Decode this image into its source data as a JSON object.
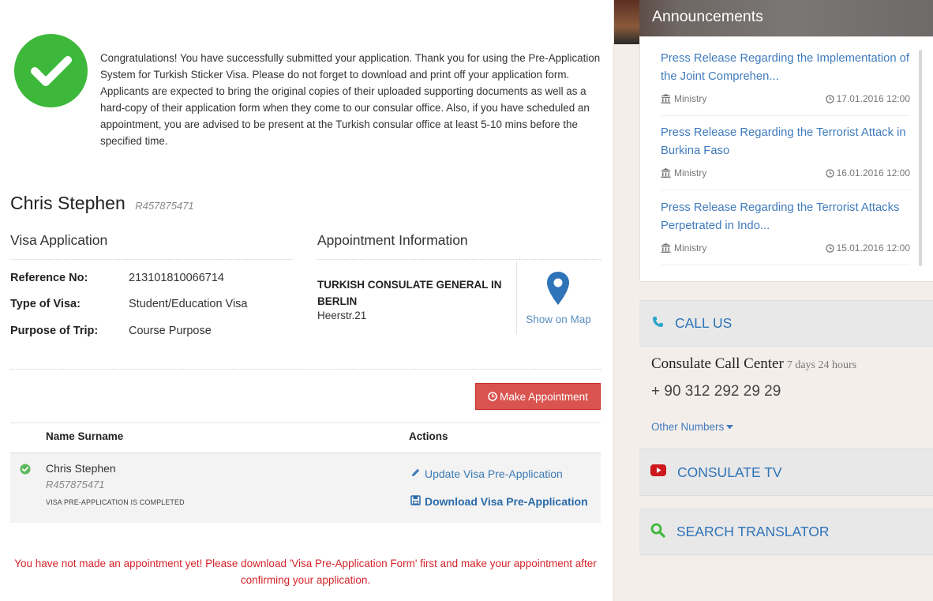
{
  "success": {
    "icon": "check-circle-icon",
    "message": "Congratulations! You have successfully submitted your application. Thank you for using the Pre-Application System for Turkish Sticker Visa. Please do not forget to download and print off your application form. Applicants are expected to bring the original copies of their uploaded supporting documents as well as a hard-copy of their application form when they come to our consular office. Also, if you have scheduled an appointment, you are advised to be present at the Turkish consular office at least 5-10 mins before the specified time."
  },
  "applicant": {
    "name": "Chris Stephen",
    "reference": "R457875471"
  },
  "visa_application": {
    "title": "Visa Application",
    "fields": [
      {
        "label": "Reference No:",
        "value": "213101810066714"
      },
      {
        "label": "Type of Visa:",
        "value": "Student/Education Visa"
      },
      {
        "label": "Purpose of Trip:",
        "value": "Course Purpose"
      }
    ]
  },
  "appointment_info": {
    "title": "Appointment Information",
    "consulate": "TURKISH CONSULATE GENERAL IN BERLIN",
    "address": "Heerstr.21",
    "map_link": "Show on Map",
    "pin_color": "#2f74b8"
  },
  "make_appointment": {
    "label": "Make Appointment",
    "icon": "clock-icon",
    "color": "#d9534f"
  },
  "table": {
    "headers": [
      "Name Surname",
      "Actions"
    ],
    "rows": [
      {
        "name": "Chris Stephen",
        "reference": "R457875471",
        "status": "VISA PRE-APPLICATION IS COMPLETED",
        "update_label": "Update Visa Pre-Application",
        "download_label": "Download Visa Pre-Application"
      }
    ]
  },
  "warning": "You have not made an appointment yet! Please download 'Visa Pre-Application Form' first and make your appointment after confirming your application.",
  "sidebar": {
    "announcements_title": "Announcements",
    "announcements": [
      {
        "title": "Press Release Regarding the Implementation of the Joint Comprehen...",
        "source": "Ministry",
        "date": "17.01.2016 12:00"
      },
      {
        "title": "Press Release Regarding the Terrorist Attack in Burkina Faso",
        "source": "Ministry",
        "date": "16.01.2016 12:00"
      },
      {
        "title": "Press Release Regarding the Terrorist Attacks Perpetrated in Indo...",
        "source": "Ministry",
        "date": "15.01.2016 12:00"
      }
    ],
    "call_us": "CALL US",
    "call_center_title": "Consulate Call Center",
    "call_center_hours": "7 days 24 hours",
    "call_center_number": "+ 90 312 292 29 29",
    "other_numbers": "Other Numbers",
    "consulate_tv": "CONSULATE TV",
    "search_translator": "SEARCH TRANSLATOR",
    "colors": {
      "link": "#3f7bbd",
      "panel": "#e8e8e8",
      "youtube": "#cc181e",
      "search": "#3db83a",
      "phone": "#2aa7c9"
    }
  }
}
